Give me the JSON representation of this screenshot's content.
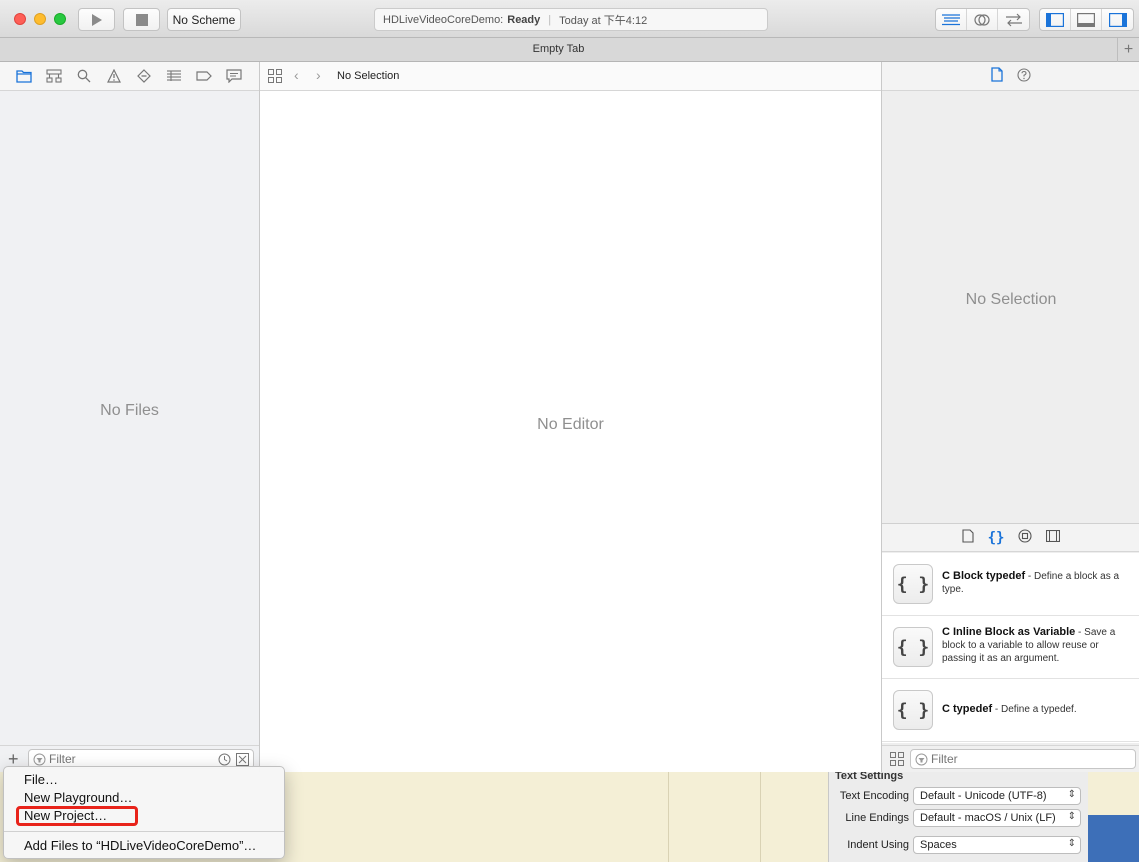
{
  "toolbar": {
    "scheme": "No Scheme",
    "activity_project": "HDLiveVideoCoreDemo:",
    "activity_status": "Ready",
    "activity_time": "Today at 下午4:12"
  },
  "tab": {
    "title": "Empty Tab"
  },
  "navigator": {
    "empty_label": "No Files",
    "filter_placeholder": "Filter"
  },
  "editor": {
    "jump_selection": "No Selection",
    "empty_label": "No Editor"
  },
  "inspector": {
    "empty_label": "No Selection",
    "library_items": [
      {
        "icon": "{ }",
        "title": "C Block typedef",
        "desc": " - Define a block as a type."
      },
      {
        "icon": "{ }",
        "title": "C Inline Block as Variable",
        "desc": " - Save a block to a variable to allow reuse or passing it as an argument."
      },
      {
        "icon": "{ }",
        "title": "C typedef",
        "desc": " - Define a typedef."
      }
    ],
    "filter_placeholder": "Filter"
  },
  "menu": {
    "items": [
      "File…",
      "New Playground…",
      "New Project…",
      "Add Files to “HDLiveVideoCoreDemo”…"
    ]
  },
  "background_panel": {
    "heading": "Text Settings",
    "rows": [
      {
        "label": "Text Encoding",
        "value": "Default - Unicode (UTF-8)"
      },
      {
        "label": "Line Endings",
        "value": "Default - macOS / Unix (LF)"
      },
      {
        "label": "Indent Using",
        "value": "Spaces"
      }
    ]
  },
  "colors": {
    "accent": "#1a73d9",
    "highlight_box": "#e8231a"
  }
}
